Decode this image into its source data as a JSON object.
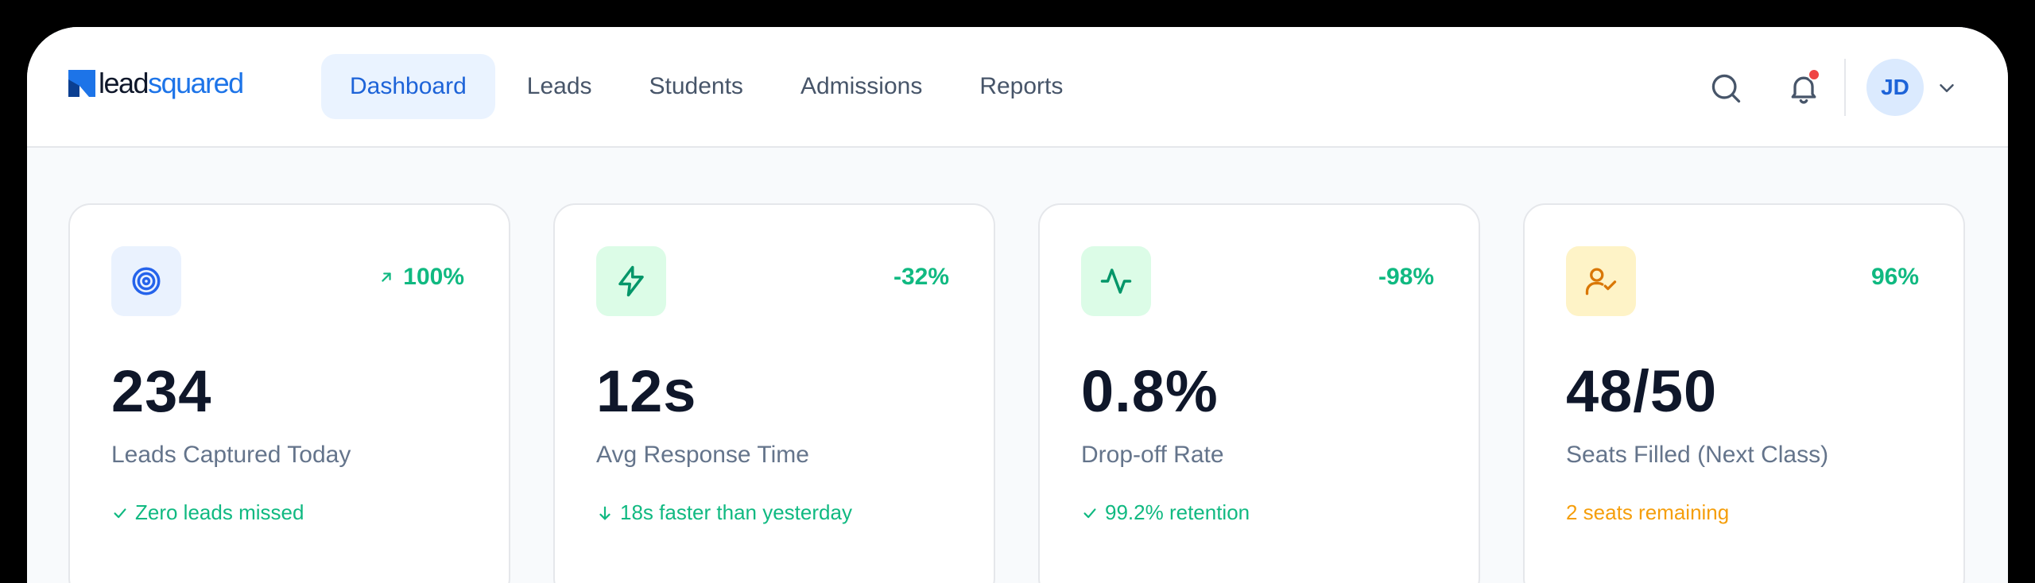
{
  "brand": {
    "name_part1": "lead",
    "name_part2": "squared"
  },
  "nav": {
    "items": [
      {
        "label": "Dashboard",
        "active": true
      },
      {
        "label": "Leads"
      },
      {
        "label": "Students"
      },
      {
        "label": "Admissions"
      },
      {
        "label": "Reports"
      }
    ]
  },
  "header": {
    "search_icon": "search-icon",
    "notification_icon": "bell-icon",
    "has_unread": true,
    "user_initials": "JD"
  },
  "colors": {
    "accent": "#1d63d8",
    "positive": "#10b981",
    "warning": "#f59e0b",
    "danger": "#ef4444"
  },
  "stats": [
    {
      "icon": "target-icon",
      "change": "100%",
      "change_icon": "arrow-up-right-icon",
      "value": "234",
      "label": "Leads Captured Today",
      "note": "Zero leads missed",
      "note_icon": "check-icon",
      "note_tone": "positive"
    },
    {
      "icon": "lightning-icon",
      "change": "-32%",
      "value": "12s",
      "label": "Avg Response Time",
      "note": "18s faster than yesterday",
      "note_icon": "arrow-down-icon",
      "note_tone": "positive"
    },
    {
      "icon": "activity-icon",
      "change": "-98%",
      "value": "0.8%",
      "label": "Drop-off Rate",
      "note": "99.2% retention",
      "note_icon": "check-icon",
      "note_tone": "positive"
    },
    {
      "icon": "user-check-icon",
      "change": "96%",
      "value": "48/50",
      "label": "Seats Filled (Next Class)",
      "note": "2 seats remaining",
      "note_tone": "warning"
    }
  ]
}
